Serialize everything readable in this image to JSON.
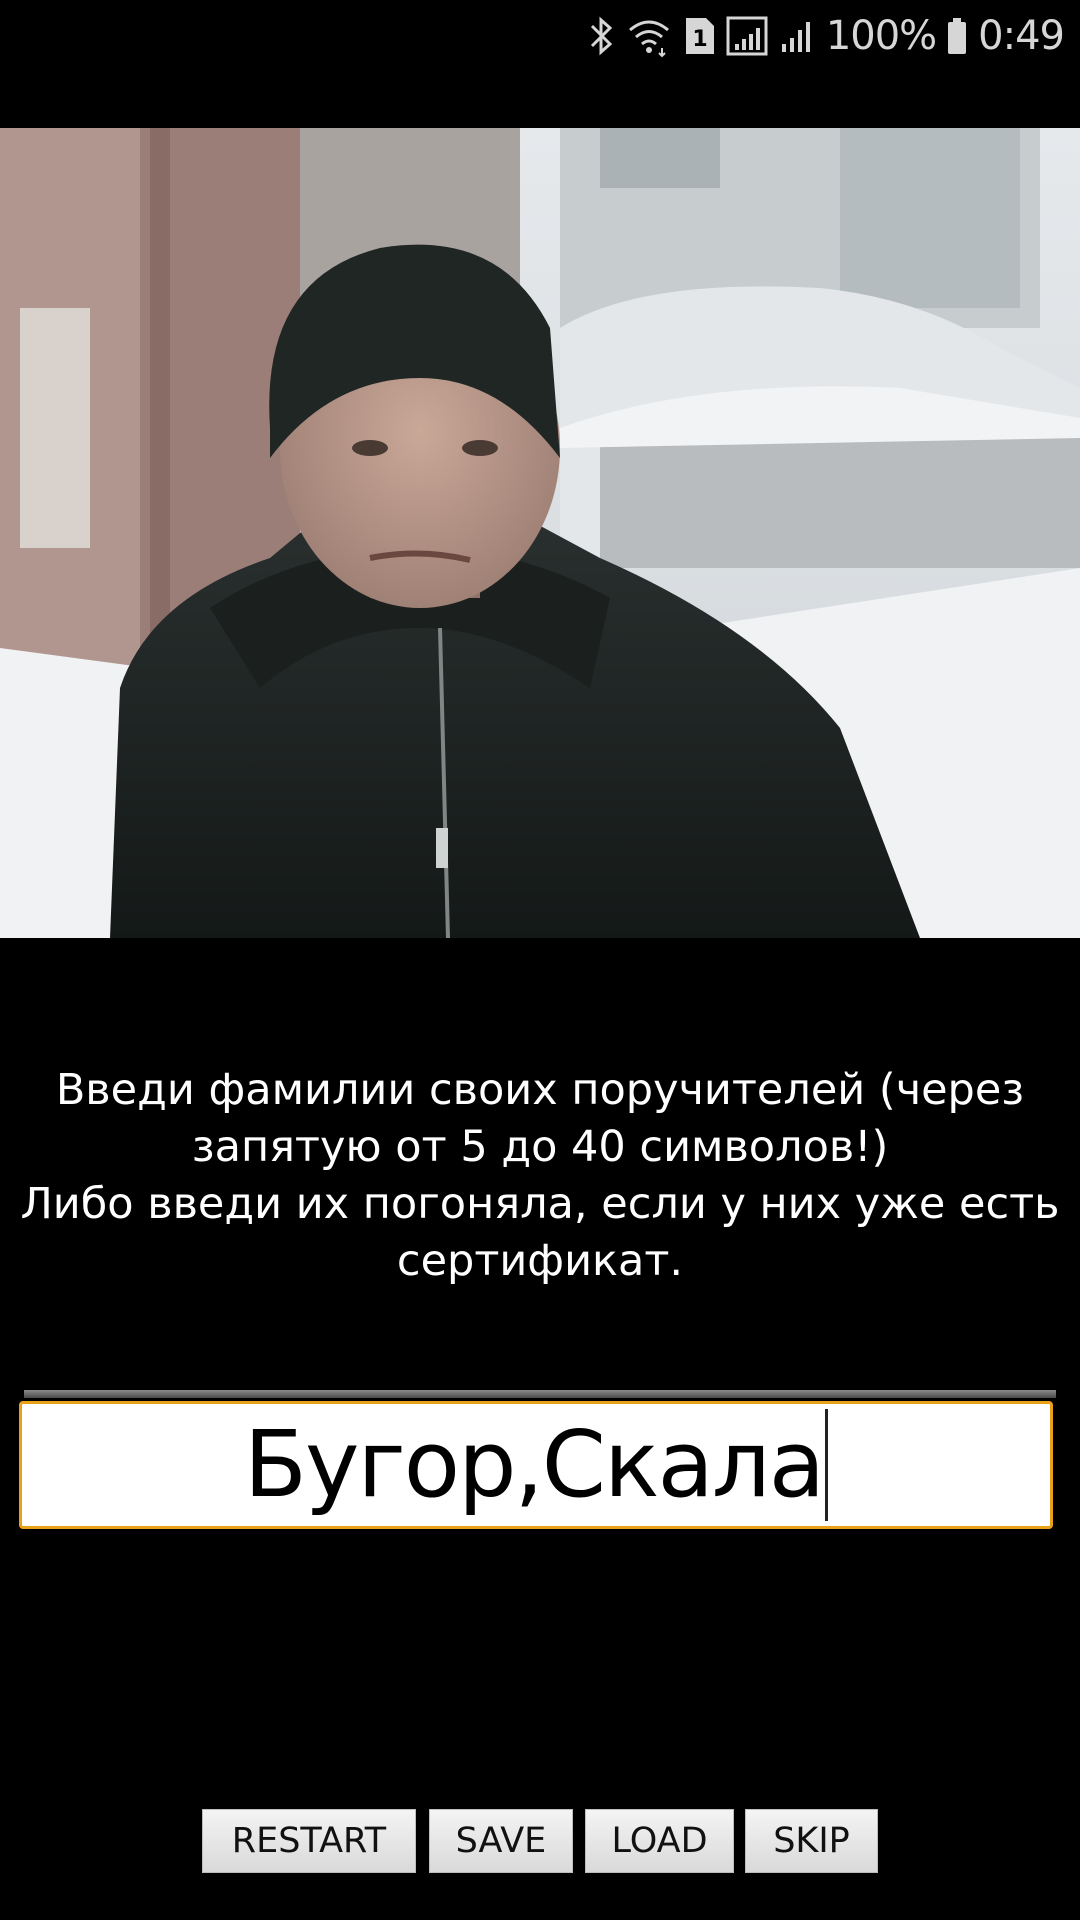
{
  "status_bar": {
    "battery_text": "100%",
    "time": "0:49",
    "sim_badge": "1",
    "icons": [
      "bluetooth-icon",
      "wifi-icon",
      "sim-1-icon",
      "signal-1-icon",
      "signal-2-icon",
      "battery-icon"
    ]
  },
  "scene": {
    "image": "man-in-black-hat-snow-photo"
  },
  "prompt": {
    "lines": [
      "Введи фамилии своих поручителей (через",
      "запятую от 5 до 40 символов!)",
      "Либо введи их погоняла, если у них уже есть",
      "сертификат."
    ]
  },
  "input": {
    "value": "Бугор,Скала"
  },
  "buttons": {
    "restart": "RESTART",
    "save": "SAVE",
    "load": "LOAD",
    "skip": "SKIP"
  },
  "colors": {
    "background": "#000000",
    "input_border": "#e8a21a",
    "text": "#ffffff"
  }
}
